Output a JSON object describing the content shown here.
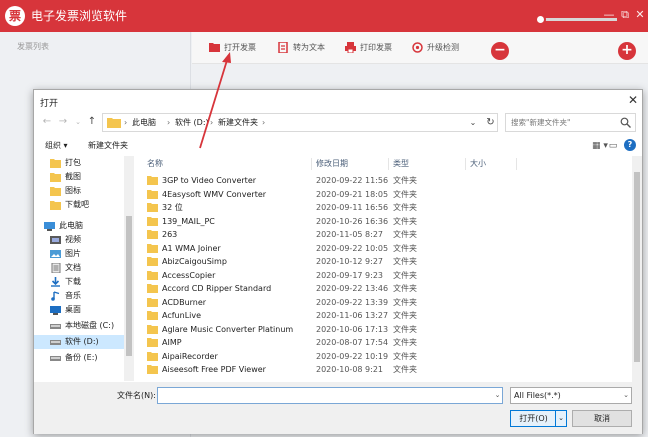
{
  "app": {
    "logo_char": "票",
    "title": "电子发票浏览软件",
    "sidebar_title": "发票列表",
    "accent": "#d7353b",
    "window_controls": {
      "min": "—",
      "max": "⧉",
      "close": "✕"
    },
    "toolbar": [
      {
        "label": "打开发票",
        "icon": "folder-icon"
      },
      {
        "label": "转为文本",
        "icon": "convert-icon"
      },
      {
        "label": "打印发票",
        "icon": "printer-icon"
      },
      {
        "label": "升级检测",
        "icon": "update-icon"
      }
    ],
    "zoom": {
      "minus": "−",
      "plus": "+",
      "level": 0.22
    }
  },
  "dialog": {
    "title": "打开",
    "close": "✕",
    "nav": {
      "back": "←",
      "forward": "→",
      "up": "↑",
      "dropdown": "⌄",
      "refresh": "↻"
    },
    "breadcrumb": [
      "此电脑",
      "软件 (D:)",
      "新建文件夹"
    ],
    "breadcrumb_sep": "›",
    "search_placeholder": "搜索\"新建文件夹\"",
    "commands": {
      "organize": "组织 ▾",
      "new_folder": "新建文件夹",
      "view": "▦ ▾",
      "pane": "▭",
      "help": "?"
    },
    "nav_pane": [
      {
        "label": "打包",
        "icon": "folder"
      },
      {
        "label": "截图",
        "icon": "folder"
      },
      {
        "label": "图标",
        "icon": "folder"
      },
      {
        "label": "下载吧",
        "icon": "folder"
      },
      {
        "label": "此电脑",
        "icon": "pc"
      },
      {
        "label": "视频",
        "icon": "video"
      },
      {
        "label": "图片",
        "icon": "picture"
      },
      {
        "label": "文档",
        "icon": "document"
      },
      {
        "label": "下载",
        "icon": "download"
      },
      {
        "label": "音乐",
        "icon": "music"
      },
      {
        "label": "桌面",
        "icon": "desktop"
      },
      {
        "label": "本地磁盘 (C:)",
        "icon": "drive"
      },
      {
        "label": "软件 (D:)",
        "icon": "drive",
        "selected": true
      },
      {
        "label": "备份 (E:)",
        "icon": "drive"
      }
    ],
    "columns": {
      "name": "名称",
      "date": "修改日期",
      "type": "类型",
      "size": "大小",
      "sort_arrow": "^"
    },
    "files": [
      {
        "name": "3GP to Video Converter",
        "date": "2020-09-22 11:56",
        "type": "文件夹"
      },
      {
        "name": "4Easysoft WMV Converter",
        "date": "2020-09-21 18:05",
        "type": "文件夹"
      },
      {
        "name": "32 位",
        "date": "2020-09-11 16:56",
        "type": "文件夹"
      },
      {
        "name": "139_MAIL_PC",
        "date": "2020-10-26 16:36",
        "type": "文件夹"
      },
      {
        "name": "263",
        "date": "2020-11-05 8:27",
        "type": "文件夹"
      },
      {
        "name": "A1 WMA Joiner",
        "date": "2020-09-22 10:05",
        "type": "文件夹"
      },
      {
        "name": "AbizCaigouSimp",
        "date": "2020-10-12 9:27",
        "type": "文件夹"
      },
      {
        "name": "AccessCopier",
        "date": "2020-09-17 9:23",
        "type": "文件夹"
      },
      {
        "name": "Accord CD Ripper Standard",
        "date": "2020-09-22 13:46",
        "type": "文件夹"
      },
      {
        "name": "ACDBurner",
        "date": "2020-09-22 13:39",
        "type": "文件夹"
      },
      {
        "name": "AcfunLive",
        "date": "2020-11-06 13:27",
        "type": "文件夹"
      },
      {
        "name": "Aglare Music Converter Platinum",
        "date": "2020-10-06 17:13",
        "type": "文件夹"
      },
      {
        "name": "AIMP",
        "date": "2020-08-07 17:54",
        "type": "文件夹"
      },
      {
        "name": "AipaiRecorder",
        "date": "2020-09-22 10:19",
        "type": "文件夹"
      },
      {
        "name": "Aiseesoft Free PDF Viewer",
        "date": "2020-10-08 9:21",
        "type": "文件夹"
      }
    ],
    "filename_label": "文件名(N):",
    "filename_value": "",
    "filter": "All Files(*.*)",
    "open_label": "打开(O)",
    "cancel_label": "取消"
  }
}
